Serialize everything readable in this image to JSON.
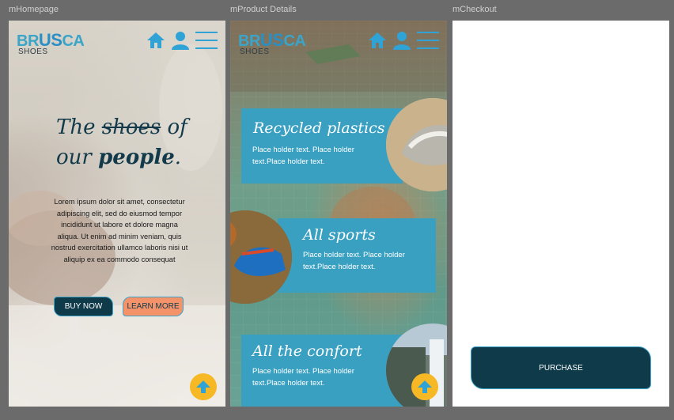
{
  "frames": {
    "home_label": "mHomepage",
    "product_label": "mProduct Details",
    "checkout_label": "mCheckout"
  },
  "logo": {
    "part1": "BR",
    "part2": "US",
    "part3": "CA",
    "sub": "SHOES"
  },
  "icons": [
    "home-icon",
    "user-icon",
    "menu-icon",
    "arrow-up-icon"
  ],
  "home": {
    "title_line1_a": "The ",
    "title_line1_strike": "shoes",
    "title_line1_b": " of",
    "title_line2_a": "our ",
    "title_line2_bold": "people",
    "title_line2_b": ".",
    "body": "Lorem ipsum dolor sit amet, consectetur adipiscing elit, sed do eiusmod tempor incididunt ut labore et dolore magna aliqua. Ut enim ad minim veniam, quis nostrud exercitation ullamco laboris nisi ut aliquip ex ea commodo consequat",
    "buy_label": "BUY NOW",
    "learn_label": "LEARN MORE"
  },
  "product": {
    "cards": [
      {
        "title": "Recycled plastics",
        "text": "Place holder text. Place holder text.Place holder text."
      },
      {
        "title": "All sports",
        "text": "Place holder text. Place holder text.Place holder text."
      },
      {
        "title": "All the confort",
        "text": "Place holder text. Place holder text.Place holder text."
      }
    ]
  },
  "checkout": {
    "purchase_label": "PURCHASE"
  },
  "colors": {
    "brand_blue": "#3aa0c2",
    "dark_teal": "#0e3a4a",
    "orange": "#f4936a",
    "yellow": "#f6b824"
  }
}
